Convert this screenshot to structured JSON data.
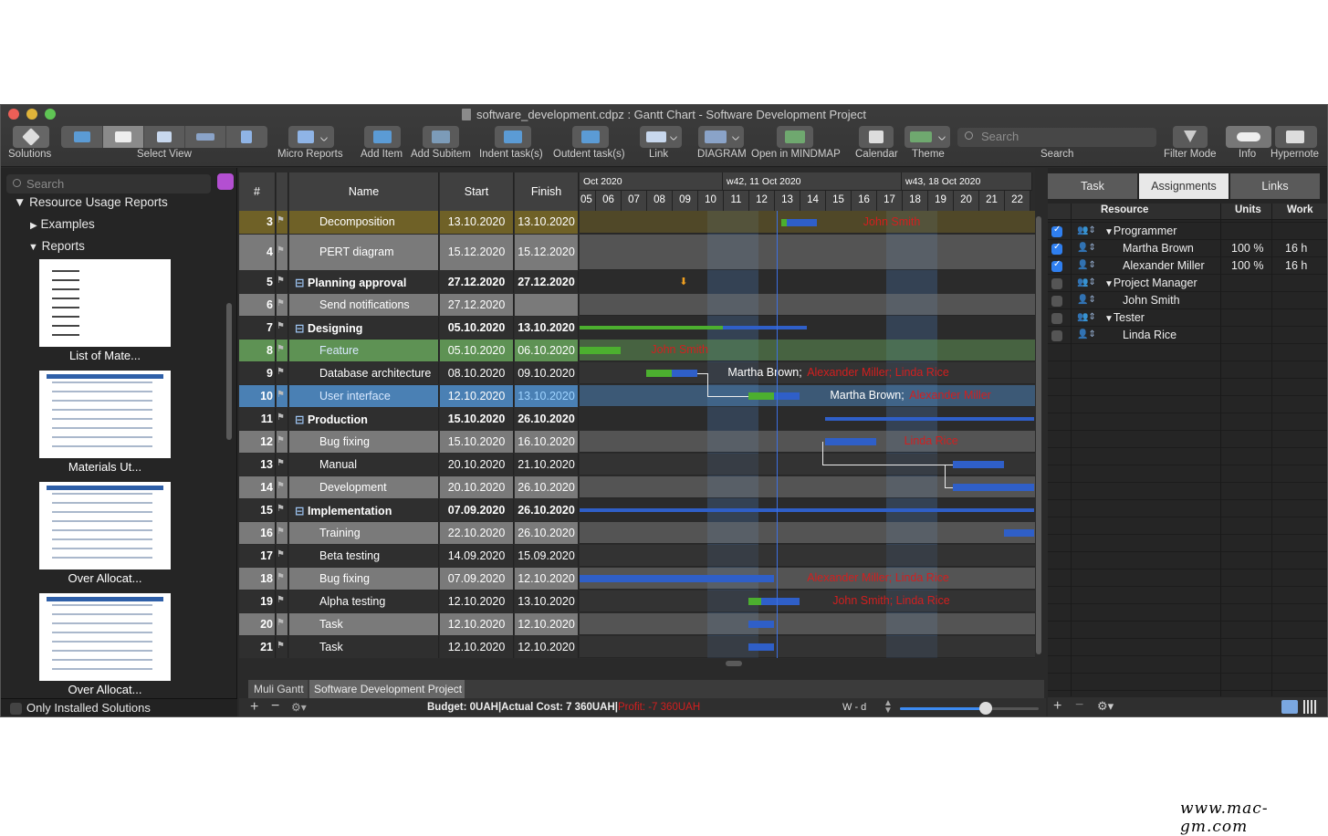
{
  "window": {
    "title": "software_development.cdpz : Gantt Chart - Software Development Project"
  },
  "toolbar": {
    "solutions": "Solutions",
    "select_view": "Select View",
    "micro_reports": "Micro Reports",
    "add_item": "Add Item",
    "add_subitem": "Add Subitem",
    "indent": "Indent task(s)",
    "outdent": "Outdent task(s)",
    "link": "Link",
    "diagram": "DIAGRAM",
    "open_mindmap": "Open in MINDMAP",
    "calendar": "Calendar",
    "theme": "Theme",
    "search_placeholder": "Search",
    "search_label": "Search",
    "filter_mode": "Filter Mode",
    "info": "Info",
    "hypernote": "Hypernote"
  },
  "sidebar": {
    "search_placeholder": "Search",
    "resource_usage_reports": "Resource Usage Reports",
    "examples": "Examples",
    "reports": "Reports",
    "thumbs": [
      "List of Mate...",
      "Materials Ut...",
      "Over Allocat...",
      "Over Allocat..."
    ],
    "only_installed": "Only Installed Solutions"
  },
  "grid": {
    "headers": {
      "num": "#",
      "name": "Name",
      "start": "Start",
      "finish": "Finish"
    },
    "weeks": [
      "Oct 2020",
      "w42, 11 Oct 2020",
      "w43, 18 Oct 2020"
    ],
    "days": [
      "05",
      "06",
      "07",
      "08",
      "09",
      "10",
      "11",
      "12",
      "13",
      "14",
      "15",
      "16",
      "17",
      "18",
      "19",
      "20",
      "21",
      "22"
    ],
    "rows": [
      {
        "n": "3",
        "name": "Decomposition",
        "start": "13.10.2020",
        "finish": "13.10.2020"
      },
      {
        "n": "4",
        "name": "PERT diagram",
        "start": "15.12.2020",
        "finish": "15.12.2020"
      },
      {
        "n": "5",
        "name": "Planning approval",
        "start": "27.12.2020",
        "finish": "27.12.2020"
      },
      {
        "n": "6",
        "name": "Send notifications",
        "start": "27.12.2020",
        "finish": ""
      },
      {
        "n": "7",
        "name": "Designing",
        "start": "05.10.2020",
        "finish": "13.10.2020"
      },
      {
        "n": "8",
        "name": "Feature",
        "start": "05.10.2020",
        "finish": "06.10.2020"
      },
      {
        "n": "9",
        "name": "Database architecture",
        "start": "08.10.2020",
        "finish": "09.10.2020"
      },
      {
        "n": "10",
        "name": "User interface",
        "start": "12.10.2020",
        "finish": "13.10.2020"
      },
      {
        "n": "11",
        "name": "Production",
        "start": "15.10.2020",
        "finish": "26.10.2020"
      },
      {
        "n": "12",
        "name": "Bug fixing",
        "start": "15.10.2020",
        "finish": "16.10.2020"
      },
      {
        "n": "13",
        "name": "Manual",
        "start": "20.10.2020",
        "finish": "21.10.2020"
      },
      {
        "n": "14",
        "name": "Development",
        "start": "20.10.2020",
        "finish": "26.10.2020"
      },
      {
        "n": "15",
        "name": "Implementation",
        "start": "07.09.2020",
        "finish": "26.10.2020"
      },
      {
        "n": "16",
        "name": "Training",
        "start": "22.10.2020",
        "finish": "26.10.2020"
      },
      {
        "n": "17",
        "name": "Beta testing",
        "start": "14.09.2020",
        "finish": "15.09.2020"
      },
      {
        "n": "18",
        "name": "Bug fixing",
        "start": "07.09.2020",
        "finish": "12.10.2020"
      },
      {
        "n": "19",
        "name": "Alpha testing",
        "start": "12.10.2020",
        "finish": "13.10.2020"
      },
      {
        "n": "20",
        "name": "Task",
        "start": "12.10.2020",
        "finish": "12.10.2020"
      },
      {
        "n": "21",
        "name": "Task",
        "start": "12.10.2020",
        "finish": "12.10.2020"
      }
    ],
    "labels": {
      "r3": "John Smith",
      "r8": "John Smith",
      "r9a": "Martha Brown; ",
      "r9b": "Alexander Miller; Linda Rice",
      "r10a": "Martha Brown; ",
      "r10b": "Alexander Miller",
      "r12": "Linda Rice",
      "r18": "Alexander Miller; Linda Rice",
      "r19": "John Smith; Linda Rice"
    }
  },
  "bottom": {
    "tab1": "Muli Gantt",
    "tab2": "Software Development Project",
    "budget": "Budget: 0UAH|Actual Cost: 7 360UAH|",
    "profit": "Profit: -7 360UAH",
    "scale": "W - d"
  },
  "right": {
    "tabs": [
      "Task",
      "Assignments",
      "Links"
    ],
    "headers": {
      "resource": "Resource",
      "units": "Units",
      "work": "Work"
    },
    "rows": [
      {
        "name": "Programmer",
        "units": "",
        "work": ""
      },
      {
        "name": "Martha Brown",
        "units": "100 %",
        "work": "16 h"
      },
      {
        "name": "Alexander Miller",
        "units": "100 %",
        "work": "16 h"
      },
      {
        "name": "Project Manager",
        "units": "",
        "work": ""
      },
      {
        "name": "John Smith",
        "units": "",
        "work": ""
      },
      {
        "name": "Tester",
        "units": "",
        "work": ""
      },
      {
        "name": "Linda Rice",
        "units": "",
        "work": ""
      }
    ]
  },
  "watermark": "www.mac-gm.com"
}
